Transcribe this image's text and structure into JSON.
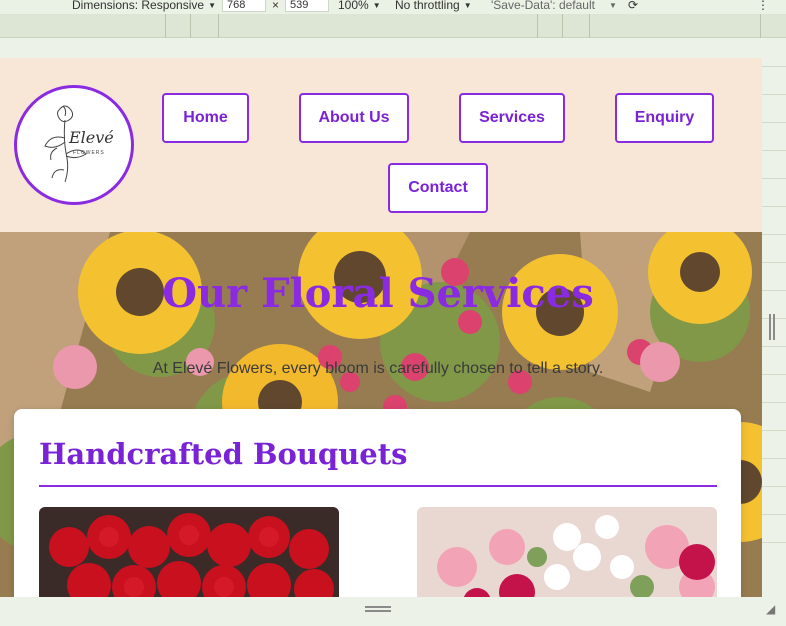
{
  "devtools": {
    "dimensions_label": "Dimensions: Responsive",
    "width_value": "768",
    "times": "×",
    "height_value": "539",
    "zoom": "100%",
    "throttling": "No throttling",
    "save_data": "'Save-Data': default",
    "more": "⋮"
  },
  "site": {
    "logo_word": "Elevé",
    "logo_sub": "FLOWERS",
    "nav": [
      "Home",
      "About Us",
      "Services",
      "Enquiry",
      "Contact"
    ],
    "accent_color": "#8a2be2",
    "header_bg": "#f8e6d7"
  },
  "hero": {
    "title": "Our Floral Services",
    "subtitle": "At Elevé Flowers, every bloom is carefully chosen to tell a story."
  },
  "section": {
    "title": "Handcrafted Bouquets"
  }
}
